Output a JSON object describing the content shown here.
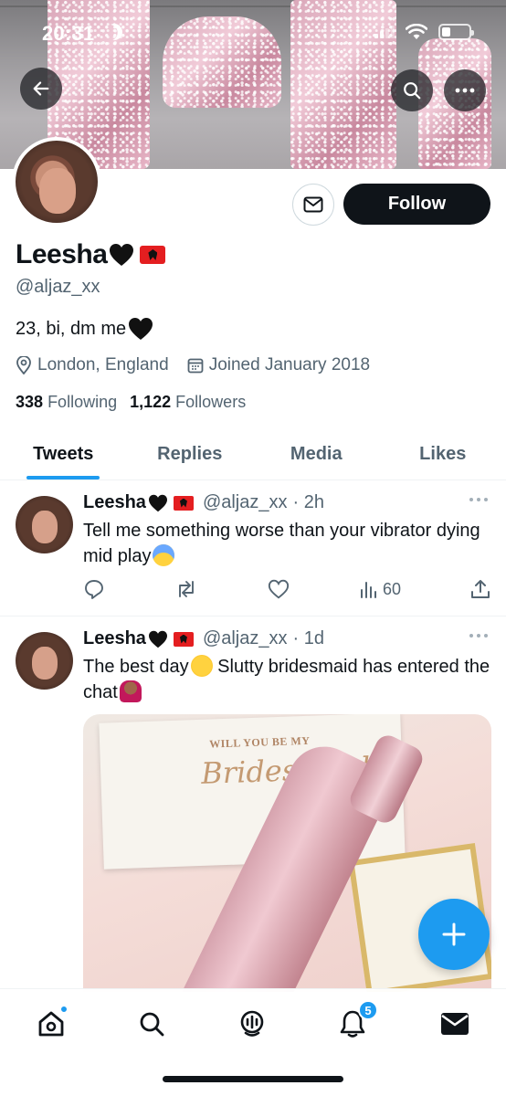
{
  "status_bar": {
    "time": "20:31",
    "battery_level": 0.25
  },
  "profile": {
    "name": "Leesha",
    "handle": "@aljaz_xx",
    "bio": "23, bi, dm me",
    "location": "London, England",
    "joined": "Joined January 2018",
    "following_count": "338",
    "following_label": "Following",
    "followers_count": "1,122",
    "followers_label": "Followers",
    "follow_label": "Follow"
  },
  "tabs": [
    {
      "label": "Tweets",
      "active": true
    },
    {
      "label": "Replies",
      "active": false
    },
    {
      "label": "Media",
      "active": false
    },
    {
      "label": "Likes",
      "active": false
    }
  ],
  "tweets": [
    {
      "name": "Leesha",
      "handle": "@aljaz_xx",
      "time": "· 2h",
      "text": "Tell me something worse than your vibrator dying mid play",
      "views": "60"
    },
    {
      "name": "Leesha",
      "handle": "@aljaz_xx",
      "time": "· 1d",
      "text": "The best day",
      "text_2": " Slutty bridesmaid has entered the chat",
      "media": {
        "card_line1": "WILL YOU BE MY",
        "card_line2": "Bridesmaid"
      }
    }
  ],
  "bottom_nav": {
    "notifications_badge": "5"
  },
  "colors": {
    "accent": "#1d9bf0",
    "text": "#0f1419",
    "secondary": "#536471",
    "flag": "#e41e20"
  }
}
